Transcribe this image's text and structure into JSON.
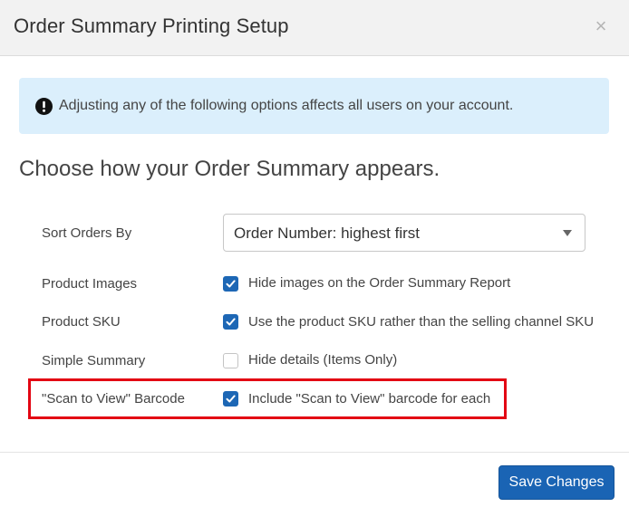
{
  "modal": {
    "title": "Order Summary Printing Setup",
    "close_glyph": "×"
  },
  "alert": {
    "icon": "exclamation-circle-icon",
    "text": "Adjusting any of the following options affects all users on your account."
  },
  "section": {
    "heading": "Choose how your Order Summary appears."
  },
  "settings": {
    "sort_orders": {
      "label": "Sort Orders By",
      "selected": "Order Number: highest first"
    },
    "product_images": {
      "label": "Product Images",
      "checked": true,
      "option": "Hide images on the Order Summary Report"
    },
    "product_sku": {
      "label": "Product SKU",
      "checked": true,
      "option": "Use the product SKU rather than the selling channel SKU"
    },
    "simple_summary": {
      "label": "Simple Summary",
      "checked": false,
      "option": "Hide details (Items Only)"
    },
    "scan_to_view": {
      "label": "\"Scan to View\" Barcode",
      "checked": true,
      "option": "Include \"Scan to View\" barcode for each"
    }
  },
  "footer": {
    "save_label": "Save Changes"
  },
  "colors": {
    "accent": "#1a64b4",
    "alert_bg": "#dbeffc",
    "highlight": "#e30613"
  }
}
